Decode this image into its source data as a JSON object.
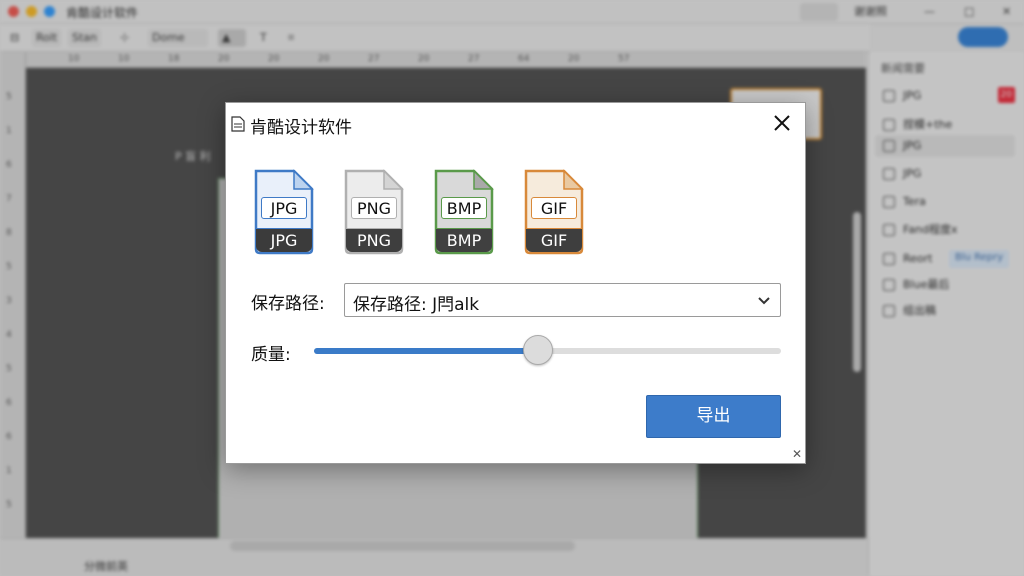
{
  "app": {
    "title": "肯酷设计软件",
    "traffic_colors": [
      "#f25f58",
      "#fbbe2e",
      "#39a0ff"
    ],
    "titlebar_right": {
      "item1": "",
      "item2": "谢谢照"
    },
    "share_button": "",
    "toolbar": [
      "Rolt",
      "Stan",
      "Dome"
    ],
    "ruler_top": [
      "10",
      "10",
      "18",
      "20",
      "20",
      "20",
      "27",
      "20",
      "27",
      "64",
      "20",
      "57"
    ],
    "ruler_left": [
      "5",
      "1",
      "6",
      "7",
      "8",
      "5",
      "3",
      "4",
      "5",
      "6",
      "6",
      "1",
      "5"
    ],
    "page_label": "P 盲 利",
    "status_text": "分微前英",
    "right_panel": {
      "title": "新闻需要",
      "layers": [
        {
          "label": "JPG",
          "badge": "20"
        },
        {
          "label": "捏模+the",
          "badge": ""
        },
        {
          "label": "JPG",
          "badge": ""
        },
        {
          "label": "JPG",
          "badge": ""
        },
        {
          "label": "Tera",
          "badge": ""
        },
        {
          "label": "Fand程度x",
          "badge": ""
        },
        {
          "label": "Reort",
          "badge": "",
          "chip": "Blu Repry"
        },
        {
          "label": "Blue最后",
          "badge": ""
        },
        {
          "label": "组出稿",
          "badge": ""
        }
      ]
    }
  },
  "dialog": {
    "title": "肯酷设计软件",
    "close_icon": "close-icon",
    "formats": [
      {
        "top_label": "JPG",
        "bottom_label": "JPG",
        "accent": "#3f7ac6",
        "page": "#e9f0fa",
        "fold": "#bcd3ef",
        "bottom_bg": "#3b3b3b",
        "selected": true
      },
      {
        "top_label": "PNG",
        "bottom_label": "PNG",
        "accent": "#b0b0b0",
        "page": "#ececec",
        "fold": "#d4d4d4",
        "bottom_bg": "#3e3e3e",
        "selected": false
      },
      {
        "top_label": "BMP",
        "bottom_label": "BMP",
        "accent": "#5a9a4a",
        "page": "#d9d9d9",
        "fold": "#a9a9a9",
        "bottom_bg": "#404040",
        "selected": false
      },
      {
        "top_label": "GIF",
        "bottom_label": "GIF",
        "accent": "#d8893a",
        "page": "#f6ebdc",
        "fold": "#e9c9a1",
        "bottom_bg": "#3e3e3e",
        "selected": false
      }
    ],
    "path_label": "保存路径:",
    "path_value": "保存路径:  J閂alk",
    "quality_label": "质量:",
    "quality": 0.48,
    "export_label": "导出",
    "accent": "#3d7cca"
  }
}
